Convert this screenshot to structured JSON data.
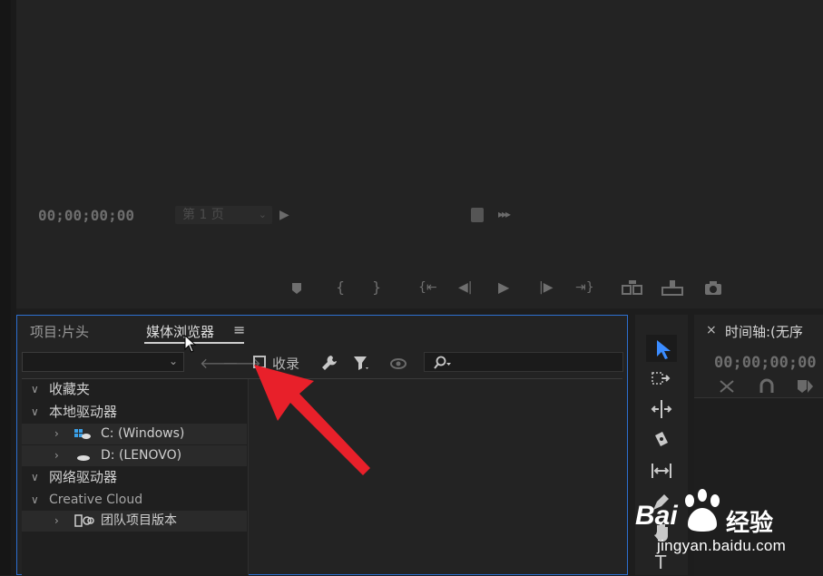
{
  "monitor": {
    "timecode": "00;00;00;00",
    "page_select": "第 1 页"
  },
  "project_panel": {
    "tabs": [
      {
        "label": "项目:片头"
      },
      {
        "label": "媒体浏览器"
      }
    ],
    "menu_icon": "≡",
    "ingest_label": "收录",
    "tree": {
      "favorites": "收藏夹",
      "local_drives": "本地驱动器",
      "drive_c": "C: (Windows)",
      "drive_d": "D: (LENOVO)",
      "network_drives": "网络驱动器",
      "creative_cloud": "Creative Cloud",
      "team_versions": "团队项目版本"
    }
  },
  "timeline": {
    "close": "×",
    "title": "时间轴:(无序",
    "timecode": "00;00;00;00"
  },
  "watermark": {
    "brand": "Bai",
    "text": "经验",
    "domain": "jingyan.baidu.com"
  },
  "colors": {
    "accent": "#2d6fd0",
    "annotation_arrow": "#e8202a",
    "selection_tool": "#3b8cff"
  }
}
